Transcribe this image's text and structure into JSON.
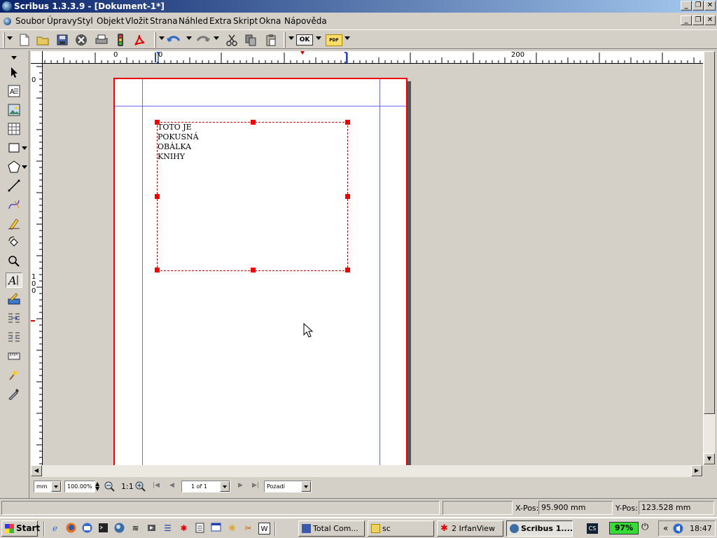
{
  "window": {
    "title": "Scribus 1.3.3.9 - [Dokument-1*]",
    "controls": {
      "minimize": "_",
      "restore": "❐",
      "close": "✕"
    }
  },
  "menubar": {
    "items": [
      "Soubor",
      "Úpravy",
      "Styl",
      "Objekt",
      "Vložit",
      "Strana",
      "Náhled",
      "Extra",
      "Skript",
      "Okna",
      "Nápověda"
    ]
  },
  "toolbar": {
    "ok_label": "OK",
    "pdf_label": "PDF"
  },
  "rulers": {
    "h_labels": [
      "0",
      "0",
      "200"
    ],
    "v_labels": [
      "0",
      "1\n0\n0"
    ]
  },
  "document": {
    "text_frame_content": "TOTO JE\nPOKUSNÁ\nOBÁLKA\nKNIHY"
  },
  "viewbar": {
    "unit": "mm",
    "zoom": "100.00%",
    "ratio": "1:1",
    "page_of": "1 of 1",
    "layer": "Pozadí"
  },
  "status": {
    "message": "",
    "xpos_label": "X-Pos:",
    "xpos_value": "95.900 mm",
    "ypos_label": "Y-Pos:",
    "ypos_value": "123.528 mm"
  },
  "taskbar": {
    "start": "Start",
    "tasks": [
      "Total Com...",
      "sc",
      "2 IrfanView",
      "Scribus 1...."
    ],
    "battery": "97%",
    "clock": "18:47",
    "tray_cs": "CS"
  },
  "colors": {
    "title_gradient_start": "#0a246a",
    "title_gradient_end": "#a6caf0",
    "page_border": "#e00000",
    "guides": "#6a6af0",
    "selection": "#e00000",
    "battery_bg": "#33dd33"
  }
}
